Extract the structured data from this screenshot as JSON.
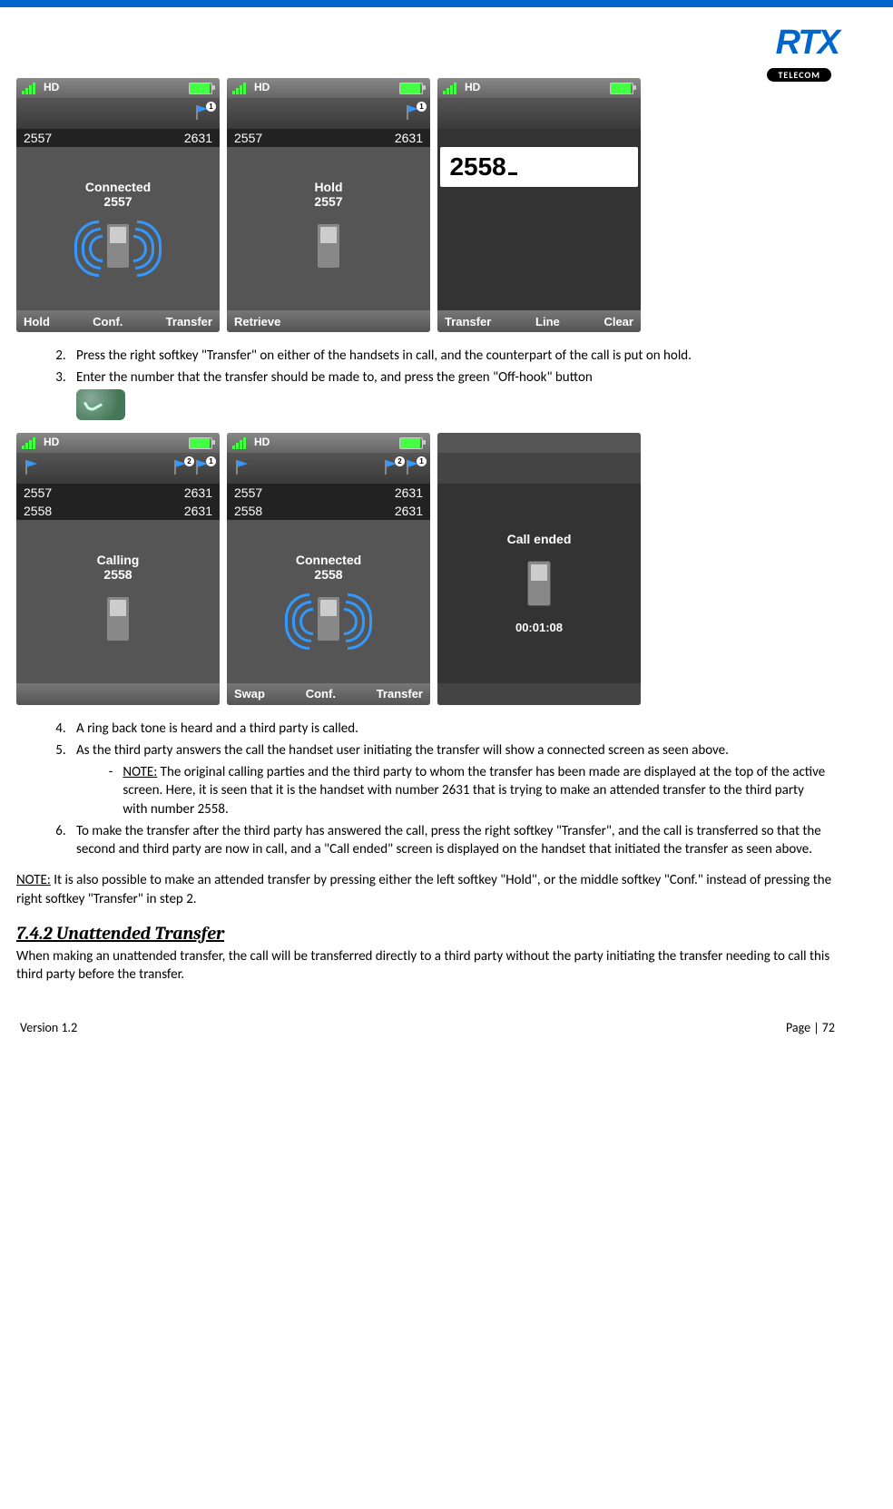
{
  "logo": {
    "main": "RTX",
    "sub": "TELECOM"
  },
  "row1": {
    "s1": {
      "hd": "HD",
      "line1a": "2557",
      "line1b": "2631",
      "status": "Connected",
      "num": "2557",
      "sk1": "Hold",
      "sk2": "Conf.",
      "sk3": "Transfer",
      "badge": "1"
    },
    "s2": {
      "hd": "HD",
      "line1a": "2557",
      "line1b": "2631",
      "status": "Hold",
      "num": "2557",
      "sk1": "Retrieve",
      "badge": "1"
    },
    "s3": {
      "hd": "HD",
      "entry": "2558",
      "sk1": "Transfer",
      "sk2": "Line",
      "sk3": "Clear"
    }
  },
  "list1": {
    "i2": "Press the right softkey \"Transfer\" on either of the handsets in call, and the counterpart of the call is put on hold.",
    "i3": "Enter the number that the transfer should be made to, and press the green \"Off-hook\" button"
  },
  "row2": {
    "s1": {
      "hd": "HD",
      "l1a": "2557",
      "l1b": "2631",
      "l2a": "2558",
      "l2b": "2631",
      "status": "Calling",
      "num": "2558",
      "b1": "2",
      "b2": "1"
    },
    "s2": {
      "hd": "HD",
      "l1a": "2557",
      "l1b": "2631",
      "l2a": "2558",
      "l2b": "2631",
      "status": "Connected",
      "num": "2558",
      "sk1": "Swap",
      "sk2": "Conf.",
      "sk3": "Transfer",
      "b1": "2",
      "b2": "1"
    },
    "s3": {
      "status": "Call ended",
      "timer": "00:01:08"
    }
  },
  "list2": {
    "i4": "A ring back tone is heard and a third party is called.",
    "i5": "As the third party answers the call the handset user initiating the transfer will show a connected screen as seen above.",
    "note_label": "NOTE:",
    "note": " The original calling parties and the third party to whom the transfer has been made are displayed at the top of the active screen. Here, it is seen that it is the handset with number 2631 that is trying to make an attended transfer to the third party with number 2558.",
    "i6": "To make the transfer after the third party has answered the call, press the right softkey \"Transfer\", and the call is transferred so that the second and third party are now in call, and a \"Call ended\" screen is displayed on the handset that initiated the transfer as seen above."
  },
  "note2_label": "NOTE:",
  "note2": " It is also possible to make an attended transfer by pressing either the left softkey \"Hold\", or the middle softkey \"Conf.\" instead of pressing the right softkey \"Transfer\" in step 2.",
  "section_heading": "7.4.2 Unattended Transfer",
  "section_body": "When making an unattended transfer, the call will be transferred directly to a third party without the party initiating the transfer needing to call this third party before the transfer.",
  "footer": {
    "left": "Version 1.2",
    "right": "Page | 72"
  }
}
